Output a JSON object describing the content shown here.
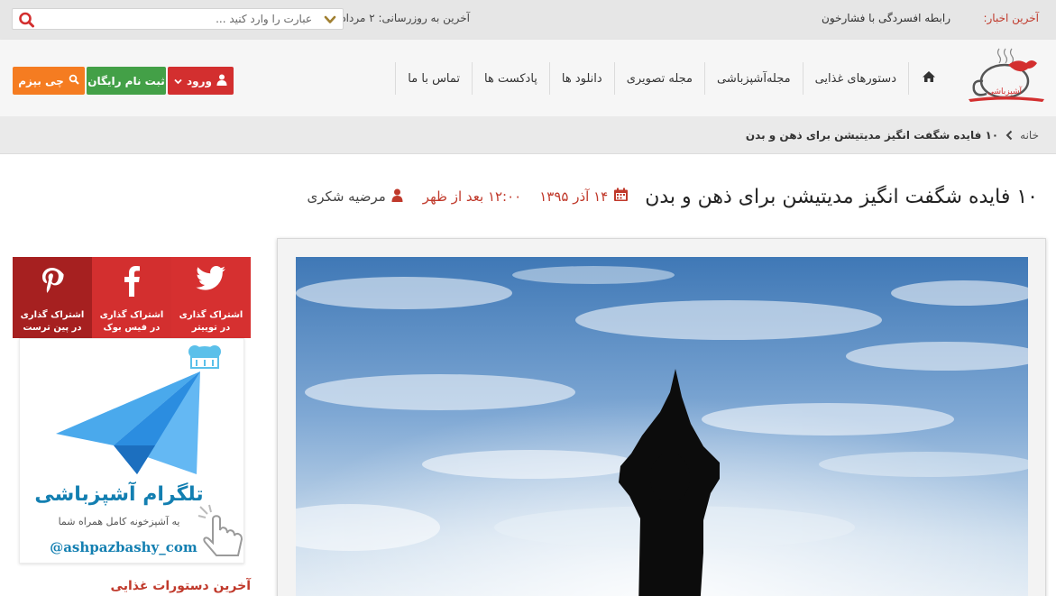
{
  "topbar": {
    "news_label": "آخرین اخبار:",
    "news_headline": "رابطه افسردگی با فشارخون",
    "update_text": "آخرین به روزرسانی: ۲ مرداد",
    "search_placeholder": "عبارت را وارد کنید ..."
  },
  "nav": {
    "items": [
      {
        "label": "دستورهای غذایی"
      },
      {
        "label": "مجله‌آشپزباشی"
      },
      {
        "label": "مجله تصویری"
      },
      {
        "label": "دانلود ها"
      },
      {
        "label": "پادکست ها"
      },
      {
        "label": "تماس با ما"
      }
    ]
  },
  "auth": {
    "login_label": "ورود",
    "register_label": "ثبت نام رایگان",
    "cook_label": "چی بپزم"
  },
  "breadcrumb": {
    "home": "خانه",
    "current": "۱۰ فایده شگفت انگیز مدیتیشن برای ذهن و بدن"
  },
  "article": {
    "title": "۱۰ فایده شگفت انگیز مدیتیشن برای ذهن و بدن",
    "date": "۱۴ آذر ۱۳۹۵",
    "time": "۱۲:۰۰ بعد از ظهر",
    "author": "مرضیه شکری"
  },
  "share": {
    "twitter_line1": "اشتراک گذاری",
    "twitter_line2": "در توییتر",
    "facebook_line1": "اشتراک گذاری",
    "facebook_line2": "در فیس بوک",
    "pinterest_line1": "اشتراک گذاری",
    "pinterest_line2": "در پین ترست"
  },
  "telegram": {
    "title": "تلگرام آشپزباشی",
    "subtitle": "یه آشپزخونه کامل همراه شما",
    "handle": "@ashpazbashy_com"
  },
  "sidebar": {
    "latest_title": "آخرین دستورات غذایی"
  },
  "logo": {
    "text": "آشپزباشی"
  },
  "colors": {
    "accent_red": "#d32f2f",
    "green": "#43a047",
    "orange": "#f57c21",
    "telegram_blue": "#137fb1"
  }
}
